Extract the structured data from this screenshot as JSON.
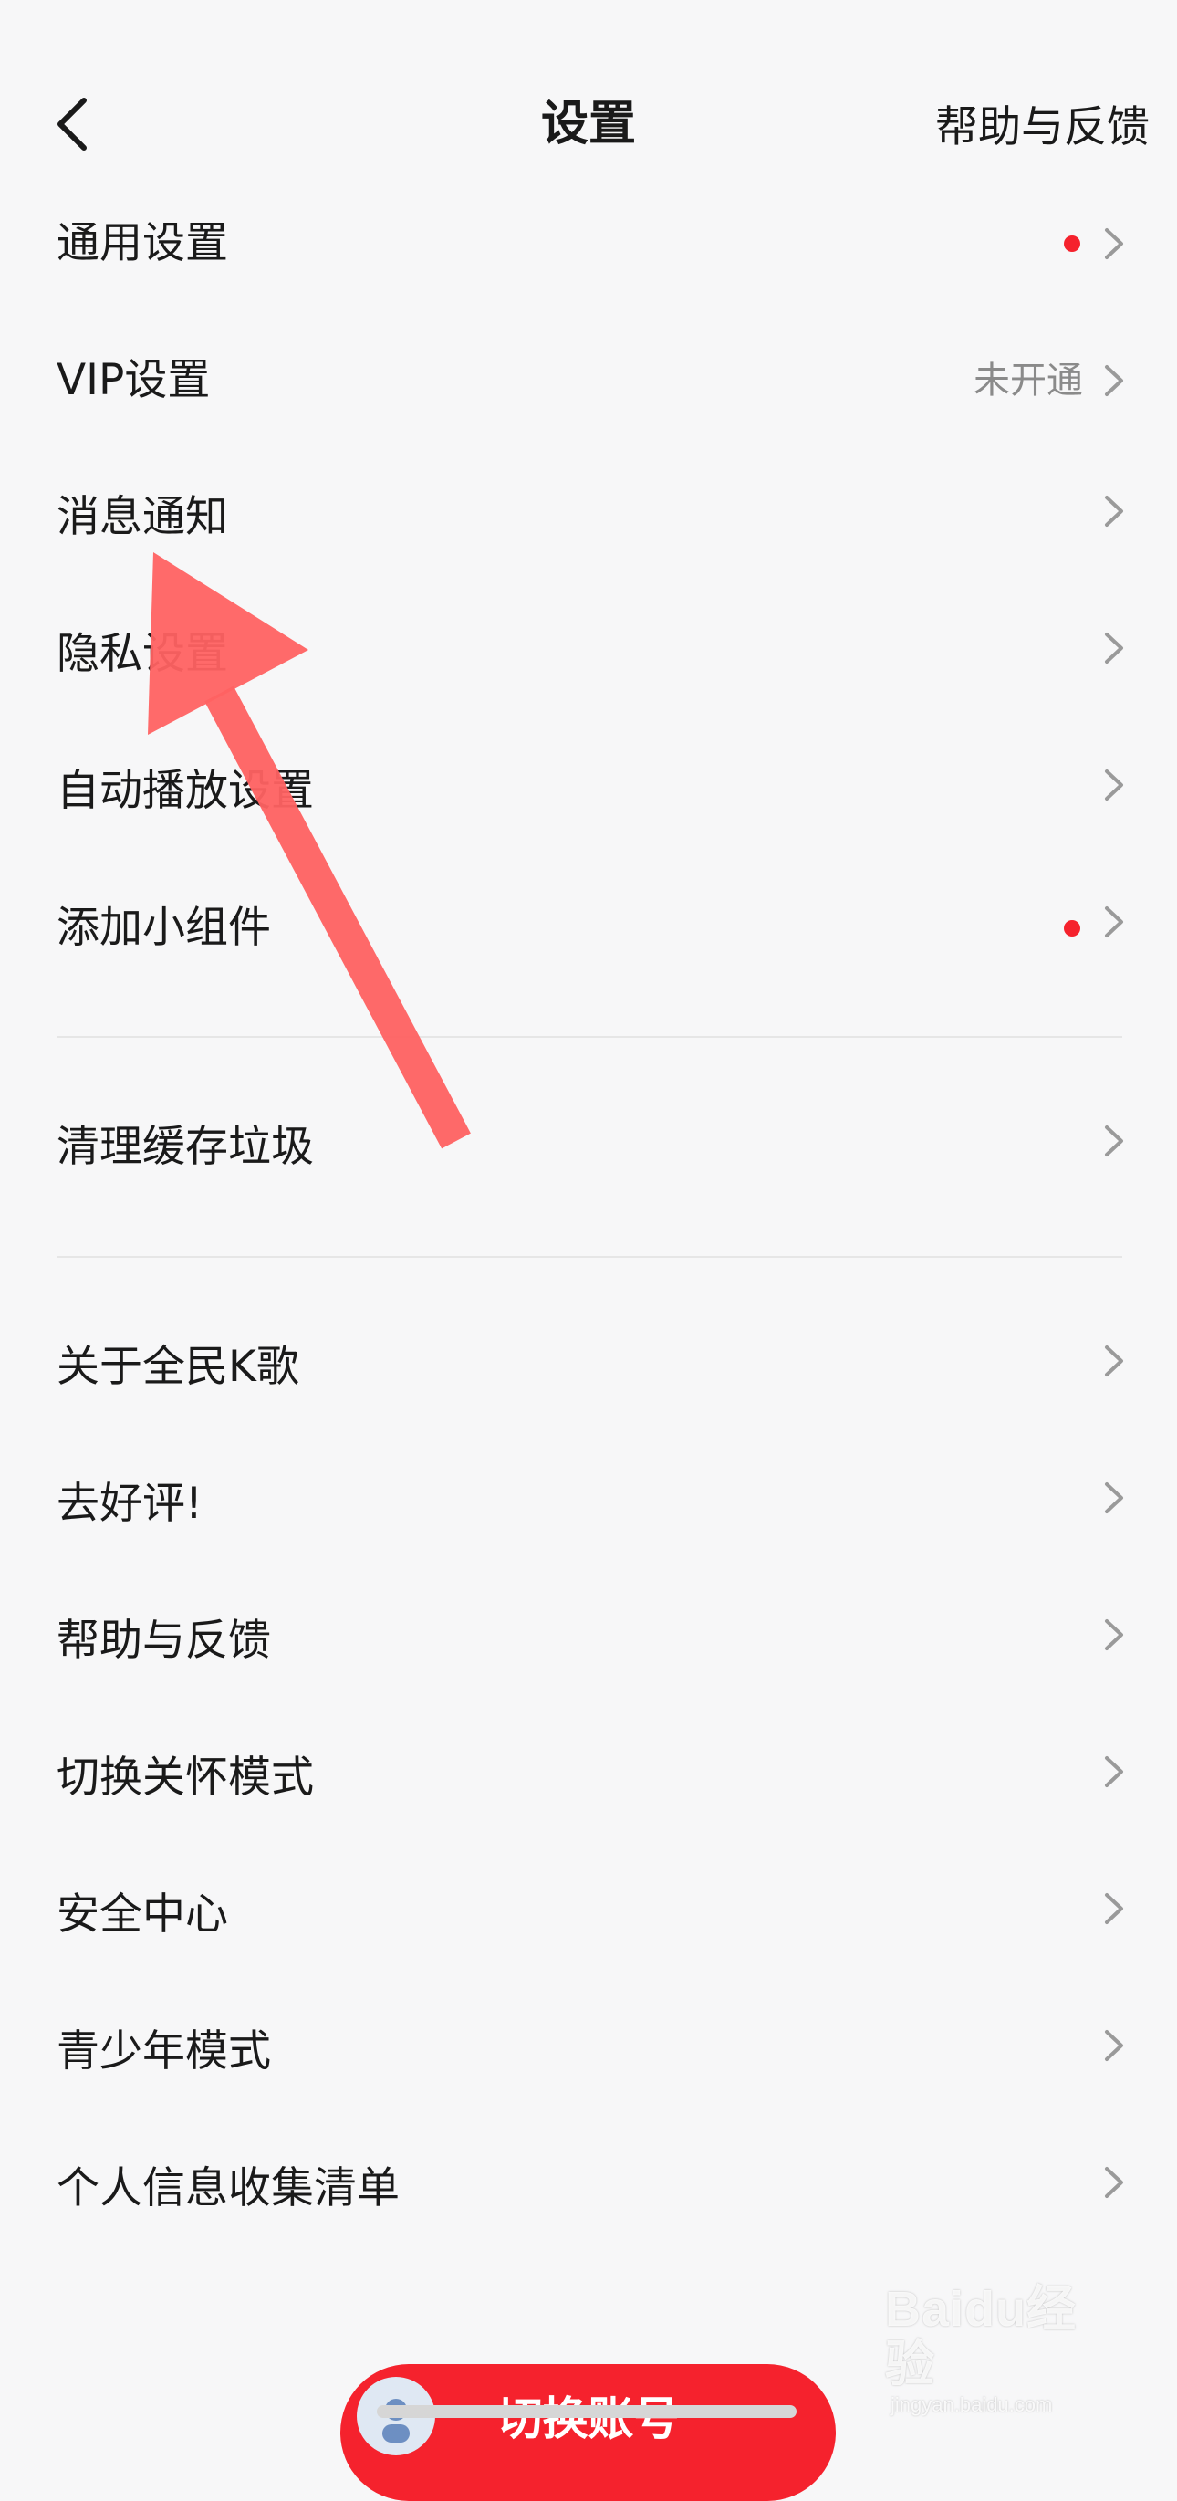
{
  "header": {
    "title": "设置",
    "help_label": "帮助与反馈"
  },
  "sections": [
    {
      "items": [
        {
          "label": "通用设置",
          "badge": "dot"
        },
        {
          "label": "VIP设置",
          "value": "未开通"
        },
        {
          "label": "消息通知"
        },
        {
          "label": "隐私设置"
        },
        {
          "label": "自动播放设置"
        },
        {
          "label": "添加小组件",
          "badge": "dot"
        }
      ]
    },
    {
      "items": [
        {
          "label": "清理缓存垃圾"
        }
      ]
    },
    {
      "items": [
        {
          "label": "关于全民K歌"
        },
        {
          "label": "去好评!"
        },
        {
          "label": "帮助与反馈"
        },
        {
          "label": "切换关怀模式"
        },
        {
          "label": "安全中心"
        },
        {
          "label": "青少年模式"
        },
        {
          "label": "个人信息收集清单"
        }
      ]
    }
  ],
  "footer": {
    "switch_account_label": "切换账号"
  },
  "watermark": {
    "logo": "Baidu经验",
    "url": "jingyan.baidu.com"
  },
  "icons": {
    "back": "chevron-left-icon",
    "row_arrow": "chevron-right-icon",
    "annotation": "red-arrow-pointer"
  },
  "colors": {
    "accent": "#f5222d",
    "background": "#f7f7f8",
    "annotation_arrow": "#ff6262"
  }
}
